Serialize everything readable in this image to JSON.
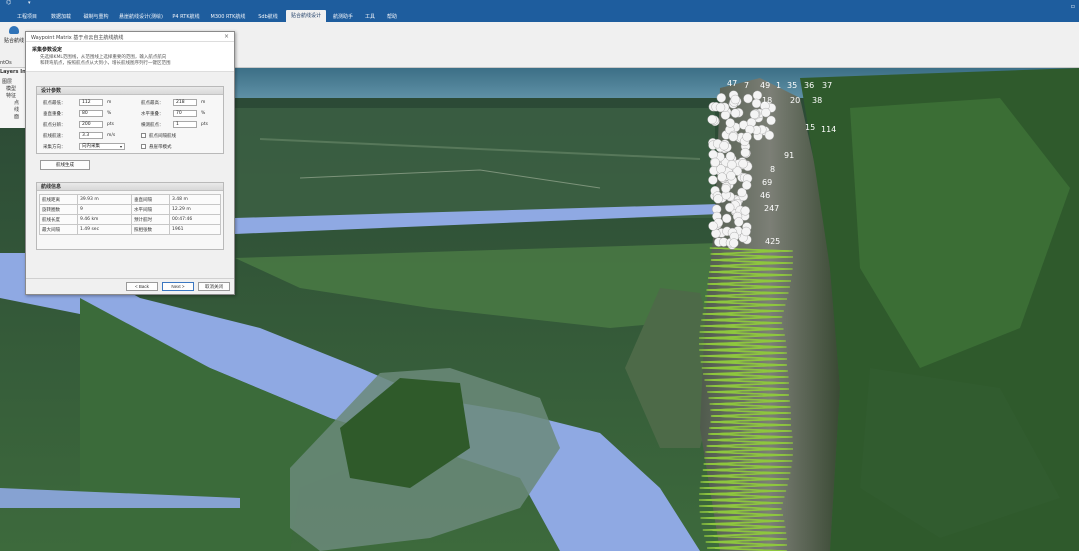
{
  "titlebar": {
    "tabs": [
      "工程项目",
      "数据加载",
      "磁制与重构",
      "悬崖航线设计(测绘)",
      "P4 RTK航线",
      "M300 RTK航线",
      "Sdb航线",
      "贴合航线设计",
      "航测助手",
      "工具",
      "帮助"
    ],
    "active_tab_index": 7
  },
  "ribbon": {
    "button_label": "贴合航线"
  },
  "left_pane": {
    "title": "ntOs",
    "header": "Layers Info",
    "items": [
      "图层",
      "模型",
      "特征",
      "点",
      "线",
      "面"
    ]
  },
  "dialog": {
    "title": "Waypoint Matrix 基于点云自主航线航线",
    "close": "×",
    "heading": "采集参数设定",
    "desc_line1": "先选择KML范围线，从范围线上选择重要的范围，输入航点航向",
    "desc_line2": "和转弯航点，按照航点点从大到小，增长航线图序列行一键区范围",
    "params_group": {
      "header": "设计参数",
      "fields": [
        {
          "label": "航点最低：",
          "value": "112",
          "unit": "m"
        },
        {
          "label": "航点最高：",
          "value": "218",
          "unit": "m"
        },
        {
          "label": "垂直重叠：",
          "value": "80",
          "unit": "%"
        },
        {
          "label": "水平重叠：",
          "value": "70",
          "unit": "%"
        },
        {
          "label": "航点分辨：",
          "value": "200",
          "unit": "pts"
        },
        {
          "label": "横测航点：",
          "value": "1",
          "unit": "pts"
        },
        {
          "label": "航线航速：",
          "value": "3.3",
          "unit": "m/s"
        }
      ],
      "direction_label": "采集方向：",
      "direction_value": "向内采集",
      "check1": "航点间隔航线",
      "check2": "悬崖带模式"
    },
    "generate_button": "航线生成",
    "info_group": {
      "header": "航线信息",
      "rows": [
        [
          "航线距离",
          "39.93 m",
          "垂直间隔",
          "3.48 m"
        ],
        [
          "旋转圈数",
          "9",
          "水平间隔",
          "12.29 m"
        ],
        [
          "航线长度",
          "9.46 km",
          "预计航时",
          "00:47:46"
        ],
        [
          "最大间隔",
          "1.49 sec",
          "照相张数",
          "1961"
        ]
      ]
    },
    "footer": {
      "back": "< Back",
      "next": "Next >",
      "cancel": "取消关闭"
    }
  },
  "viewport": {
    "waypoint_labels": [
      "47",
      "49",
      "1",
      "35",
      "36",
      "37",
      "7",
      "18",
      "20",
      "38",
      "15",
      "114",
      "91",
      "69",
      "46",
      "425",
      "247",
      "8"
    ],
    "route_color": "#8ec63f",
    "river_color": "#8fa9e3"
  }
}
